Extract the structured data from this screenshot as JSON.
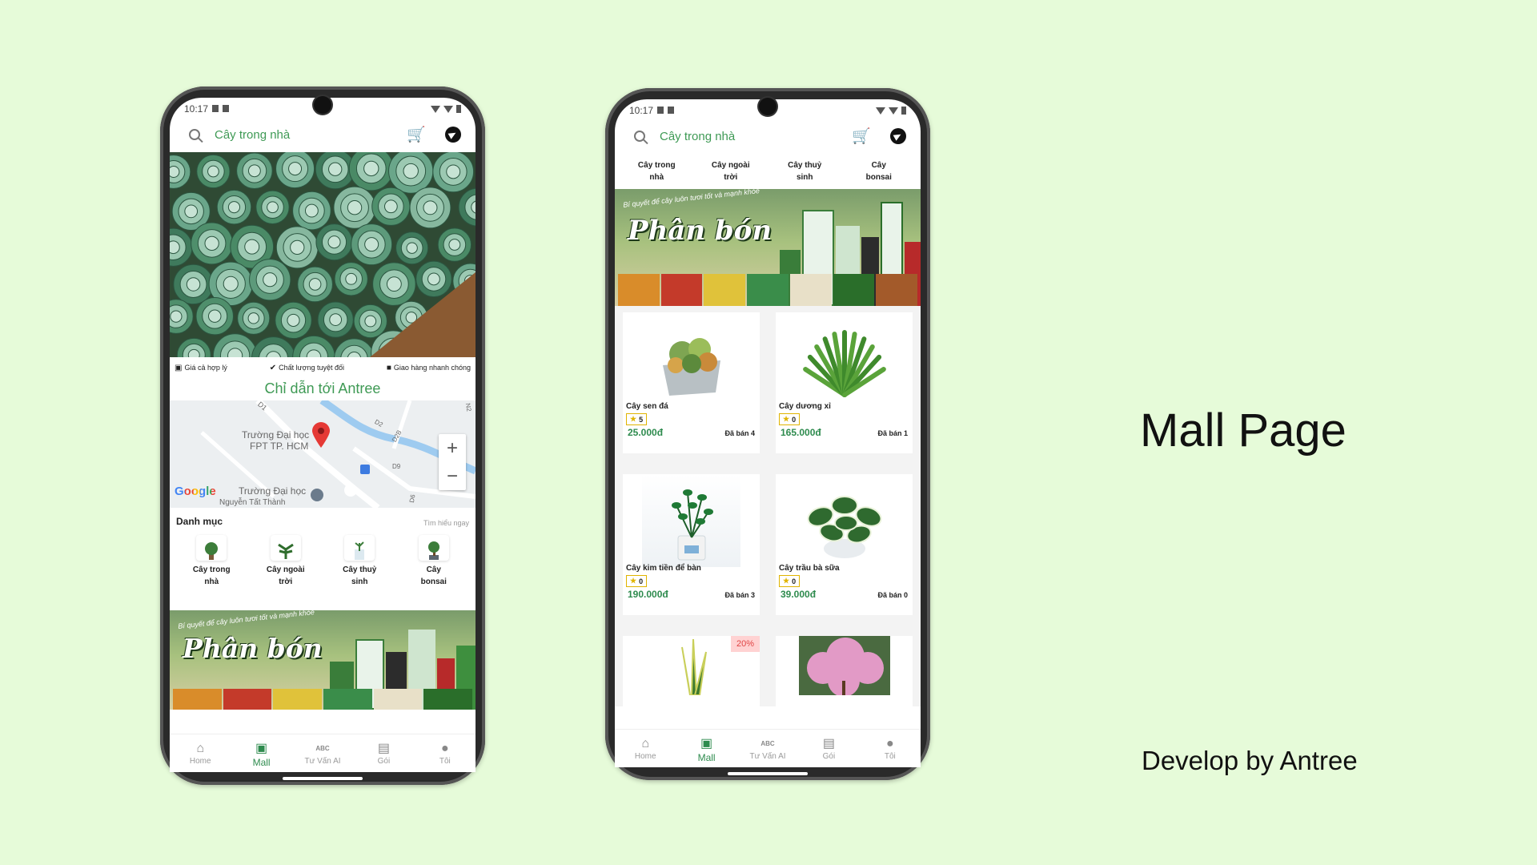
{
  "status": {
    "time": "10:17"
  },
  "search": {
    "placeholder": "Cây trong nhà"
  },
  "features": [
    {
      "icon": "money-icon",
      "label": "Giá cả hợp lý"
    },
    {
      "icon": "check-circle-icon",
      "label": "Chất lượng tuyệt đối"
    },
    {
      "icon": "truck-icon",
      "label": "Giao hàng nhanh chóng"
    }
  ],
  "guide": {
    "title": "Chỉ dẫn tới Antree"
  },
  "map": {
    "labels": [
      "Trường Đại học",
      "FPT TP. HCM",
      "Trường Đại học",
      "Nguyễn Tất Thành",
      "D1",
      "D2",
      "D2B",
      "D9",
      "D6",
      "N2"
    ],
    "brand": "Google",
    "zoom_in": "+",
    "zoom_out": "−"
  },
  "categories": {
    "title": "Danh mục",
    "more": "Tìm hiểu ngay",
    "items": [
      {
        "line1": "Cây trong",
        "line2": "nhà"
      },
      {
        "line1": "Cây ngoài",
        "line2": "trời"
      },
      {
        "line1": "Cây thuỷ",
        "line2": "sinh"
      },
      {
        "line1": "Cây",
        "line2": "bonsai"
      }
    ]
  },
  "banner": {
    "tagline": "Bí quyết để cây luôn tươi tốt và mạnh khỏe",
    "title": "Phân bón"
  },
  "nav": [
    {
      "icon": "home-icon",
      "label": "Home"
    },
    {
      "icon": "shopping-bag-icon",
      "label": "Mall"
    },
    {
      "icon": "abc-icon",
      "label": "Tư Vấn AI"
    },
    {
      "icon": "calendar-icon",
      "label": "Gói"
    },
    {
      "icon": "person-icon",
      "label": "Tôi"
    }
  ],
  "nav_icons_text": {
    "abc": "ABC"
  },
  "products": [
    {
      "name": "Cây sen đá",
      "rating": "5",
      "price": "25.000đ",
      "sold": "Đã bán 4"
    },
    {
      "name": "Cây dương xỉ",
      "rating": "0",
      "price": "165.000đ",
      "sold": "Đã bán 1"
    },
    {
      "name": "Cây kim tiền để bàn",
      "rating": "0",
      "price": "190.000đ",
      "sold": "Đã bán 3"
    },
    {
      "name": "Cây trầu bà sữa",
      "rating": "0",
      "price": "39.000đ",
      "sold": "Đã bán 0"
    }
  ],
  "discount": "20%",
  "heading": "Mall Page",
  "credit": "Develop by Antree",
  "colors": {
    "background": "#e6fbd9",
    "brand_green": "#2e8b4e",
    "search_green": "#3f9a55",
    "star": "#e0b400"
  }
}
